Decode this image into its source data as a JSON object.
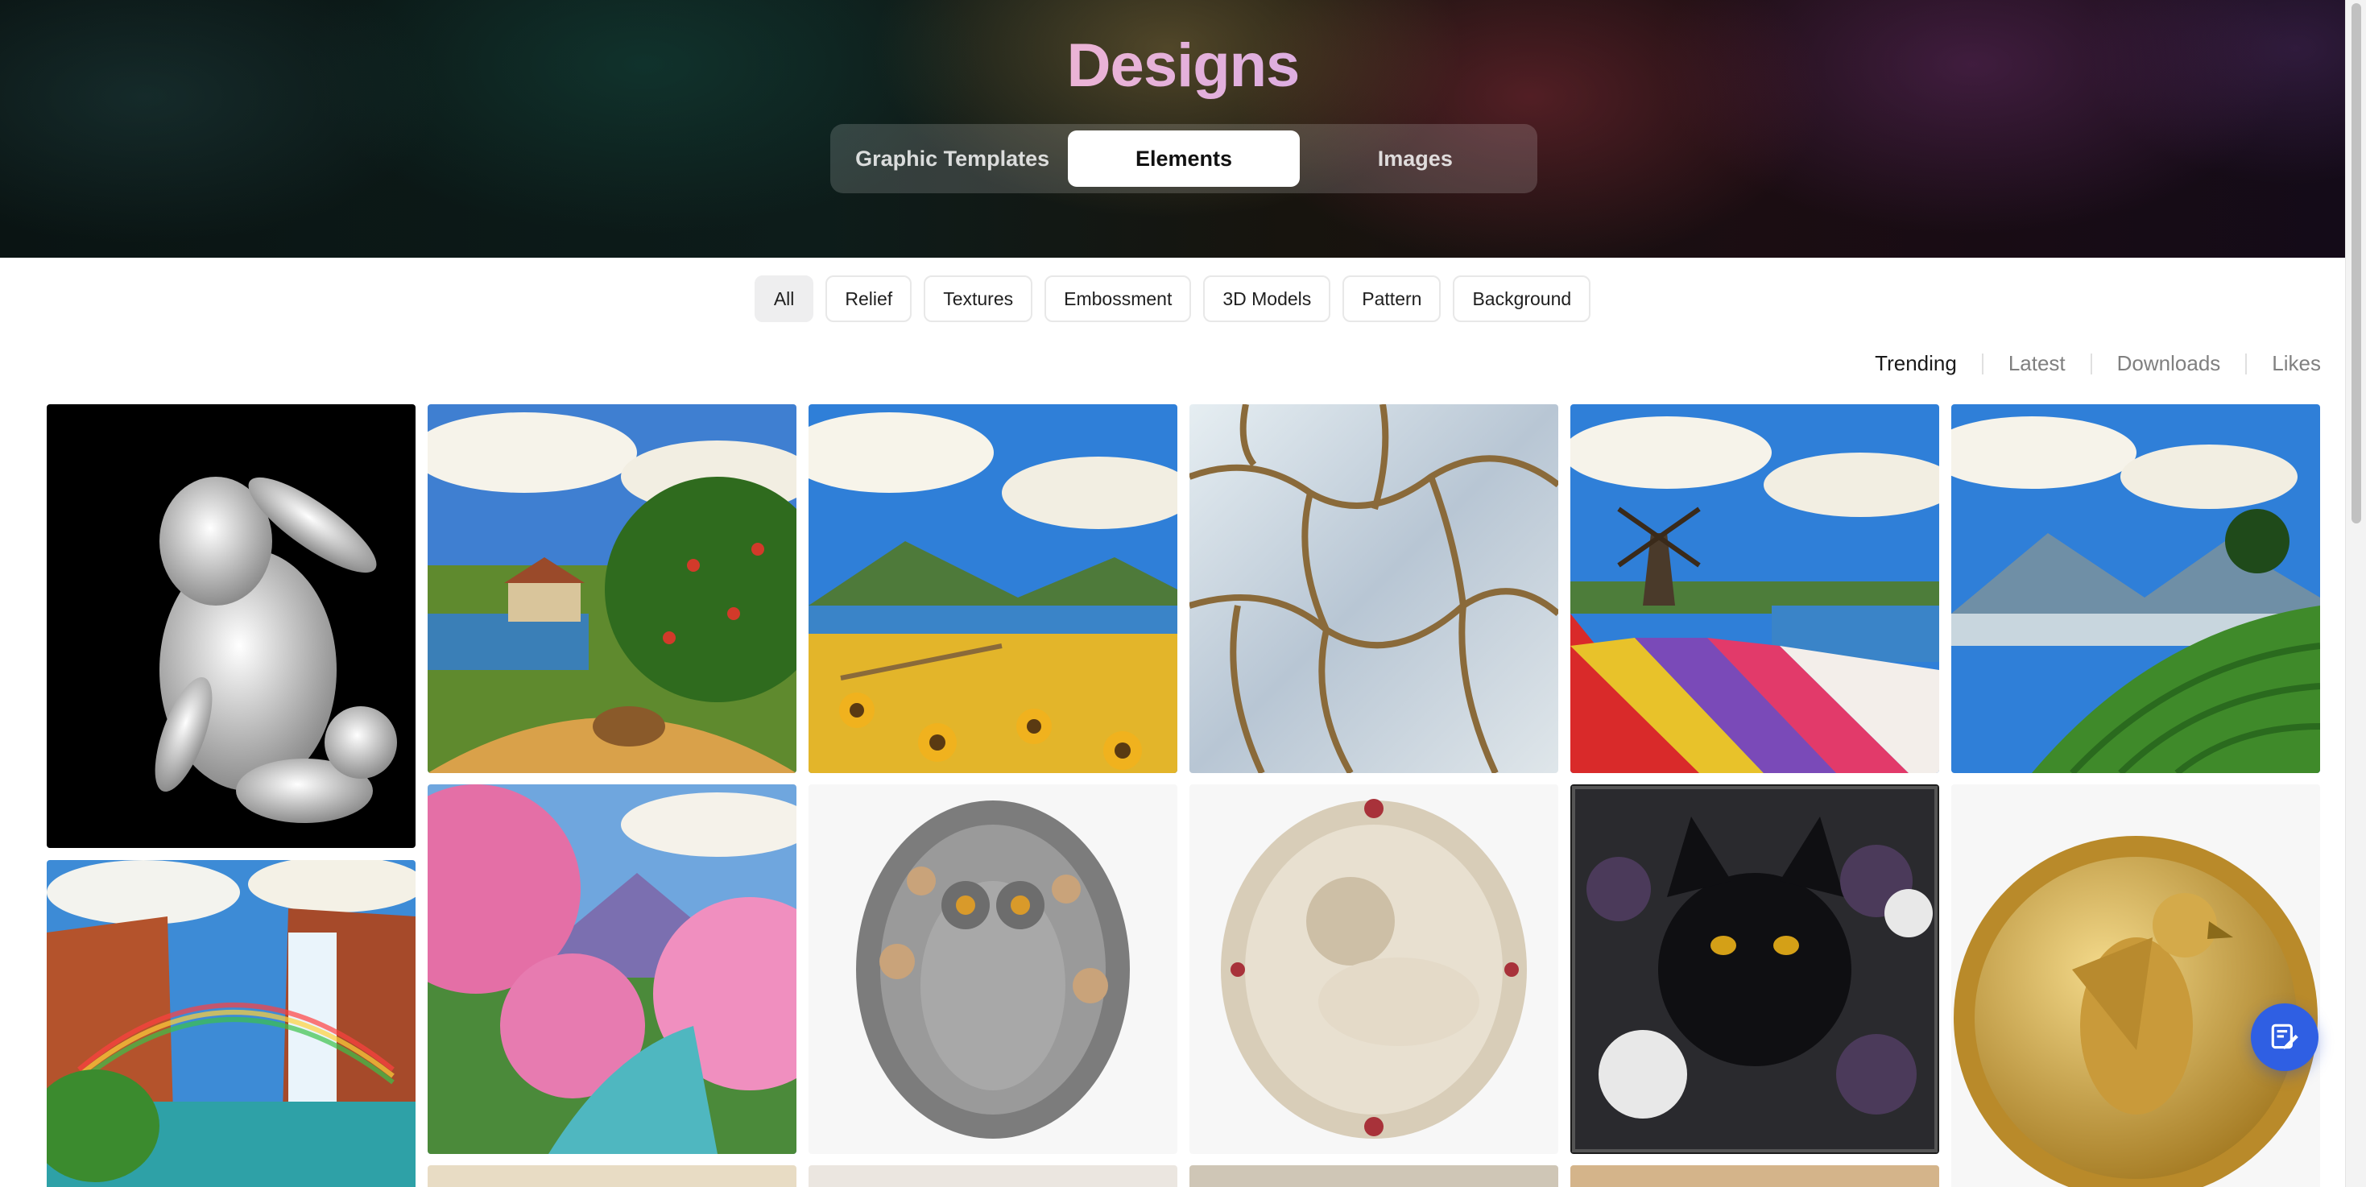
{
  "hero": {
    "title": "Designs",
    "tabs": [
      {
        "label": "Graphic Templates",
        "active": false
      },
      {
        "label": "Elements",
        "active": true
      },
      {
        "label": "Images",
        "active": false
      }
    ]
  },
  "filters": [
    "All",
    "Relief",
    "Textures",
    "Embossment",
    "3D Models",
    "Pattern",
    "Background"
  ],
  "active_filter": "All",
  "sort": {
    "options": [
      "Trending",
      "Latest",
      "Downloads",
      "Likes"
    ],
    "active": "Trending"
  },
  "fab": {
    "icon": "edit-note-icon"
  },
  "colors": {
    "accent": "#2f5fe3",
    "active_tab_bg": "#ffffff",
    "chip_active_bg": "#eeeeef"
  }
}
